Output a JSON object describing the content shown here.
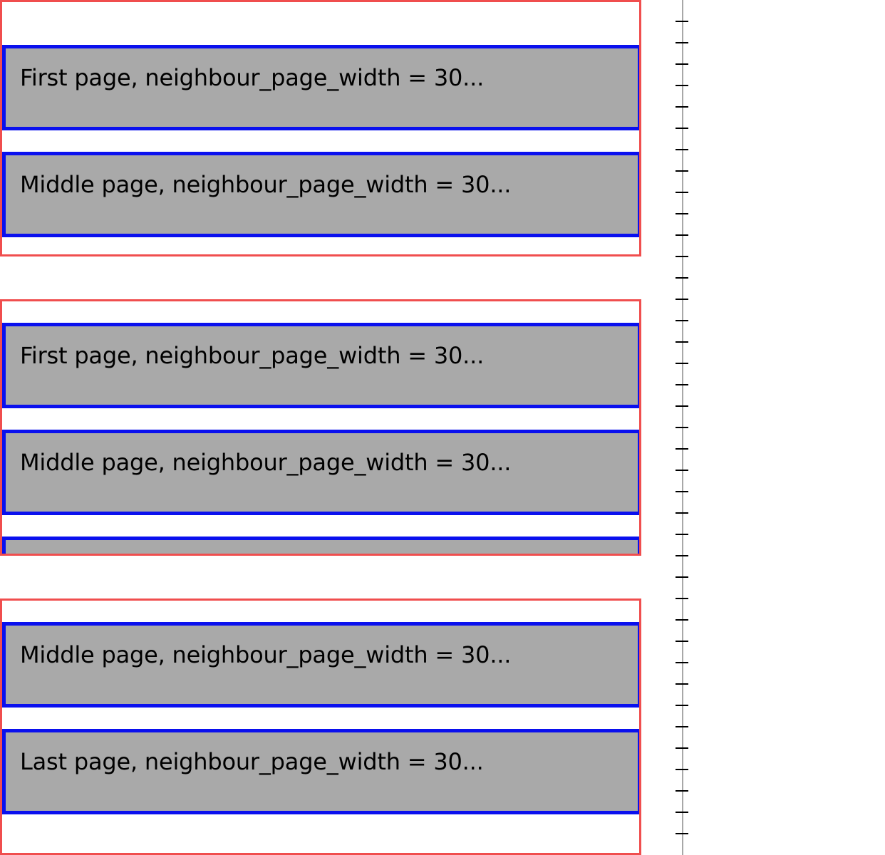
{
  "galleries": [
    {
      "pages": [
        {
          "label": "First page, neighbour_page_width = 30..."
        },
        {
          "label": "Middle page, neighbour_page_width = 30..."
        }
      ]
    },
    {
      "pages": [
        {
          "label": "First page, neighbour_page_width = 30..."
        },
        {
          "label": "Middle page, neighbour_page_width = 30..."
        },
        {
          "label": ""
        }
      ]
    },
    {
      "pages": [
        {
          "label": "Middle page, neighbour_page_width = 30..."
        },
        {
          "label": "Last page, neighbour_page_width = 30..."
        }
      ]
    }
  ],
  "colors": {
    "gallery_border": "#f04e4e",
    "page_border": "#0a10ee",
    "page_fill": "#a9a9a9",
    "ruler_line": "#a8a8a8",
    "ruler_tick": "#000000"
  }
}
